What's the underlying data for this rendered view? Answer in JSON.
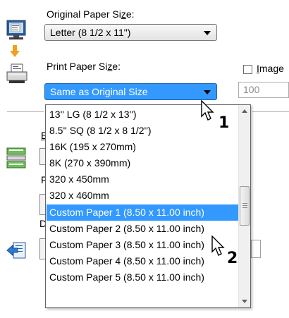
{
  "original_paper_size": {
    "label_before": "Original Paper Si",
    "label_mnemonic": "z",
    "label_after": "e:",
    "value": "Letter (8 1/2 x 11\")"
  },
  "print_paper_size": {
    "label_before": "Print Paper Si",
    "label_mnemonic": "z",
    "label_after": "e:",
    "value": "Same as Original Size"
  },
  "image_option": {
    "label_mnemonic": "I",
    "label_rest": "mage"
  },
  "number_field": {
    "value": "100"
  },
  "dropdown": {
    "items": [
      "13'' LG (8 1/2 x 13'')",
      "8.5'' SQ (8 1/2 x 8 1/2'')",
      "16K (195 x 270mm)",
      "8K (270 x 390mm)",
      "320 x 450mm",
      "320 x 460mm",
      "Custom Paper 1 (8.50 x 11.00 inch)",
      "Custom Paper 2 (8.50 x 11.00 inch)",
      "Custom Paper 3 (8.50 x 11.00 inch)",
      "Custom Paper 4 (8.50 x 11.00 inch)",
      "Custom Paper 5 (8.50 x 11.00 inch)"
    ],
    "selected_index": 6
  },
  "hidden_labels": {
    "letter_e": "E",
    "letter_f": "F",
    "letter_d": "D"
  },
  "annotations": {
    "step1": "1",
    "step2": "2"
  },
  "colors": {
    "selection": "#3399ff",
    "window_bg": "#ffffff"
  },
  "icons": [
    "monitor-icon",
    "down-arrow-icon",
    "printer-icon",
    "paper-tray-icon",
    "document-arrow-icon"
  ]
}
